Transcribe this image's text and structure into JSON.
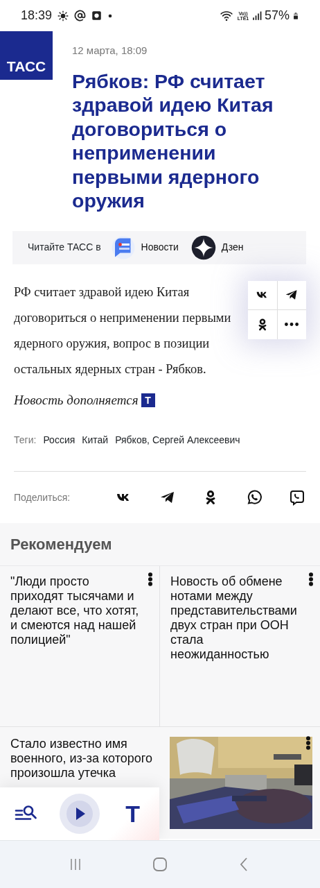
{
  "status_bar": {
    "time": "18:39",
    "network": "Vo)) LTE1",
    "battery": "57%"
  },
  "header": {
    "logo": "ТАСС",
    "date": "12 марта, 18:09",
    "title": "Рябков: РФ считает здравой идею Китая договориться о неприменении первыми ядерного оружия"
  },
  "read_in": {
    "label": "Читайте ТАСС в",
    "services": [
      {
        "kind": "news",
        "label": "Новости"
      },
      {
        "kind": "dzen",
        "label": "Дзен"
      }
    ]
  },
  "share_grid": [
    {
      "kind": "vk"
    },
    {
      "kind": "telegram"
    },
    {
      "kind": "ok"
    },
    {
      "kind": "more"
    }
  ],
  "lead": "РФ считает здравой идею Китая договориться о неприменении первыми ядерного оружия, вопрос в позиции остальных ядерных стран - Рябков.",
  "update_note": {
    "text": "Новость дополняется",
    "badge": "Т"
  },
  "tags": {
    "label": "Теги:",
    "items": [
      "Россия",
      "Китай",
      "Рябков, Сергей Алексеевич"
    ]
  },
  "share": {
    "label": "Поделиться:",
    "items": [
      {
        "kind": "vk"
      },
      {
        "kind": "telegram"
      },
      {
        "kind": "ok"
      },
      {
        "kind": "whatsapp"
      },
      {
        "kind": "viber"
      }
    ]
  },
  "recommended": {
    "title": "Рекомендуем",
    "items": [
      {
        "text": "\"Люди просто приходят тысячами и делают все, что хотят, и смеются над нашей полицией\""
      },
      {
        "text": "Новость об обмене нотами между представительствами двух стран при ООН стала неожиданностью"
      },
      {
        "text": "Стало известно имя военного, из-за которого произошла утечка",
        "kind": "picture"
      }
    ]
  },
  "bottom_toolbar": {
    "logo": "Т"
  }
}
